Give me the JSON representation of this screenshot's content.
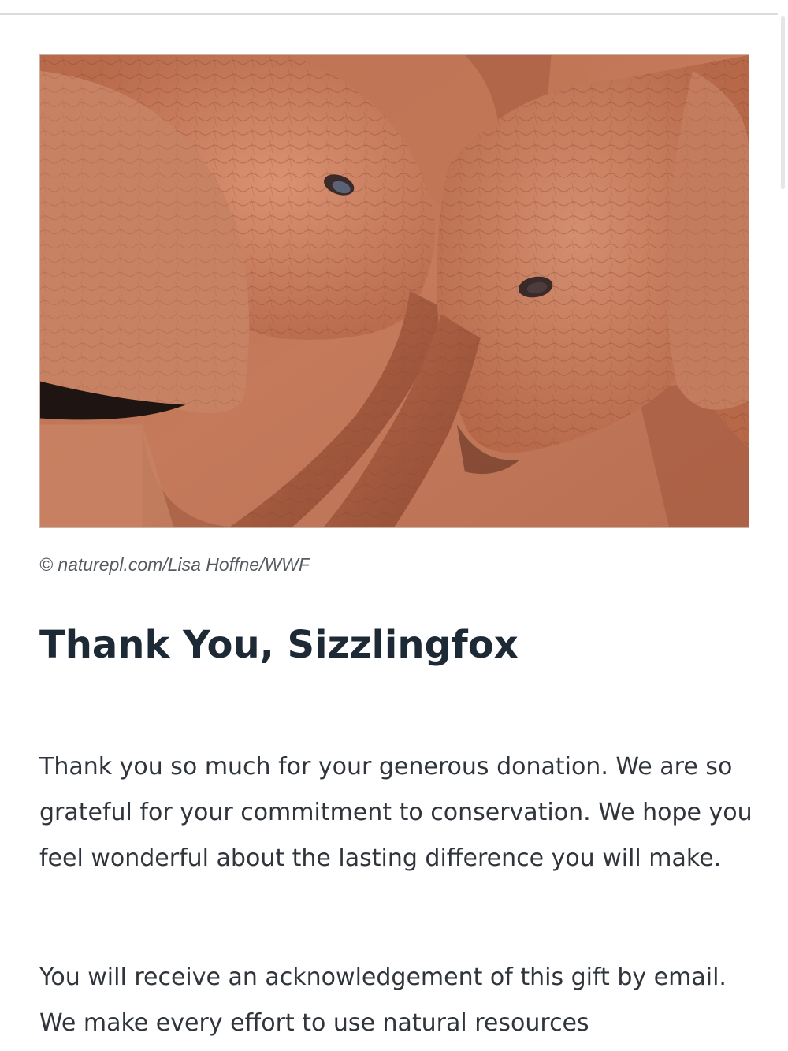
{
  "image": {
    "alt": "Two baby elephants touching trunks",
    "credit": "© naturepl.com/Lisa Hoffne/WWF"
  },
  "heading": "Thank You, Sizzlingfox",
  "paragraphs": [
    "Thank you so much for your generous donation. We are so grateful for your commitment to conservation. We hope you feel wonderful about the lasting difference you will make.",
    "You will receive an acknowledgement of this gift by email. We make every effort to use natural resources"
  ],
  "colors": {
    "heading": "#1e2936",
    "body_text": "#2f353b",
    "credit_text": "#555b61",
    "hero_tone": "#c97e5e"
  }
}
